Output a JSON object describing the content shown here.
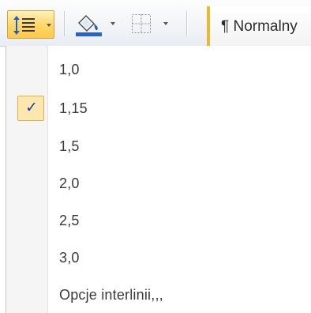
{
  "ribbon": {
    "line_spacing_button": {
      "icon": "line-spacing-icon",
      "active": true
    },
    "shading_button": {
      "icon": "paint-bucket-icon"
    },
    "borders_button": {
      "icon": "borders-icon"
    },
    "style_gallery": {
      "label": "¶ Normalny",
      "accent_color": "#e8b934"
    }
  },
  "menu": {
    "items": [
      {
        "label": "1,0"
      },
      {
        "label": "1,15",
        "checked": true
      },
      {
        "label": "1,5"
      },
      {
        "label": "2,0"
      },
      {
        "label": "2,5"
      },
      {
        "label": "3,0"
      },
      {
        "label": "Opcje interlinii,,,"
      }
    ],
    "check_glyph": "✓",
    "check_color": "#1b3f9a"
  }
}
